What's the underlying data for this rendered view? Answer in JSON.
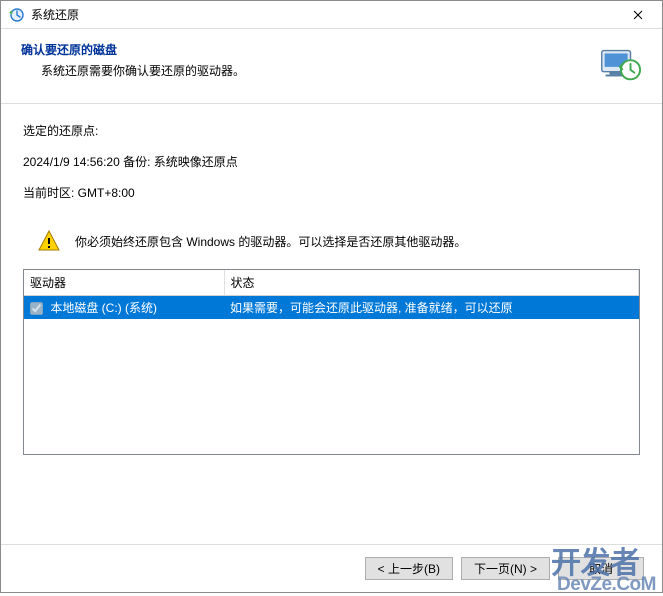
{
  "titlebar": {
    "title": "系统还原"
  },
  "header": {
    "title": "确认要还原的磁盘",
    "subtitle": "系统还原需要你确认要还原的驱动器。"
  },
  "content": {
    "selected_point_label": "选定的还原点:",
    "restore_point_line": "2024/1/9 14:56:20 备份: 系统映像还原点",
    "timezone_line": "当前时区: GMT+8:00",
    "warning": "你必须始终还原包含 Windows 的驱动器。可以选择是否还原其他驱动器。"
  },
  "table": {
    "headers": {
      "drive": "驱动器",
      "status": "状态"
    },
    "rows": [
      {
        "checked": true,
        "drive": "本地磁盘 (C:) (系统)",
        "status": "如果需要，可能会还原此驱动器, 准备就绪，可以还原"
      }
    ]
  },
  "footer": {
    "back": "< 上一步(B)",
    "next": "下一页(N) >",
    "cancel": "取消"
  },
  "watermark": {
    "line1": "开发者",
    "line2": "DevZe.CoM"
  }
}
